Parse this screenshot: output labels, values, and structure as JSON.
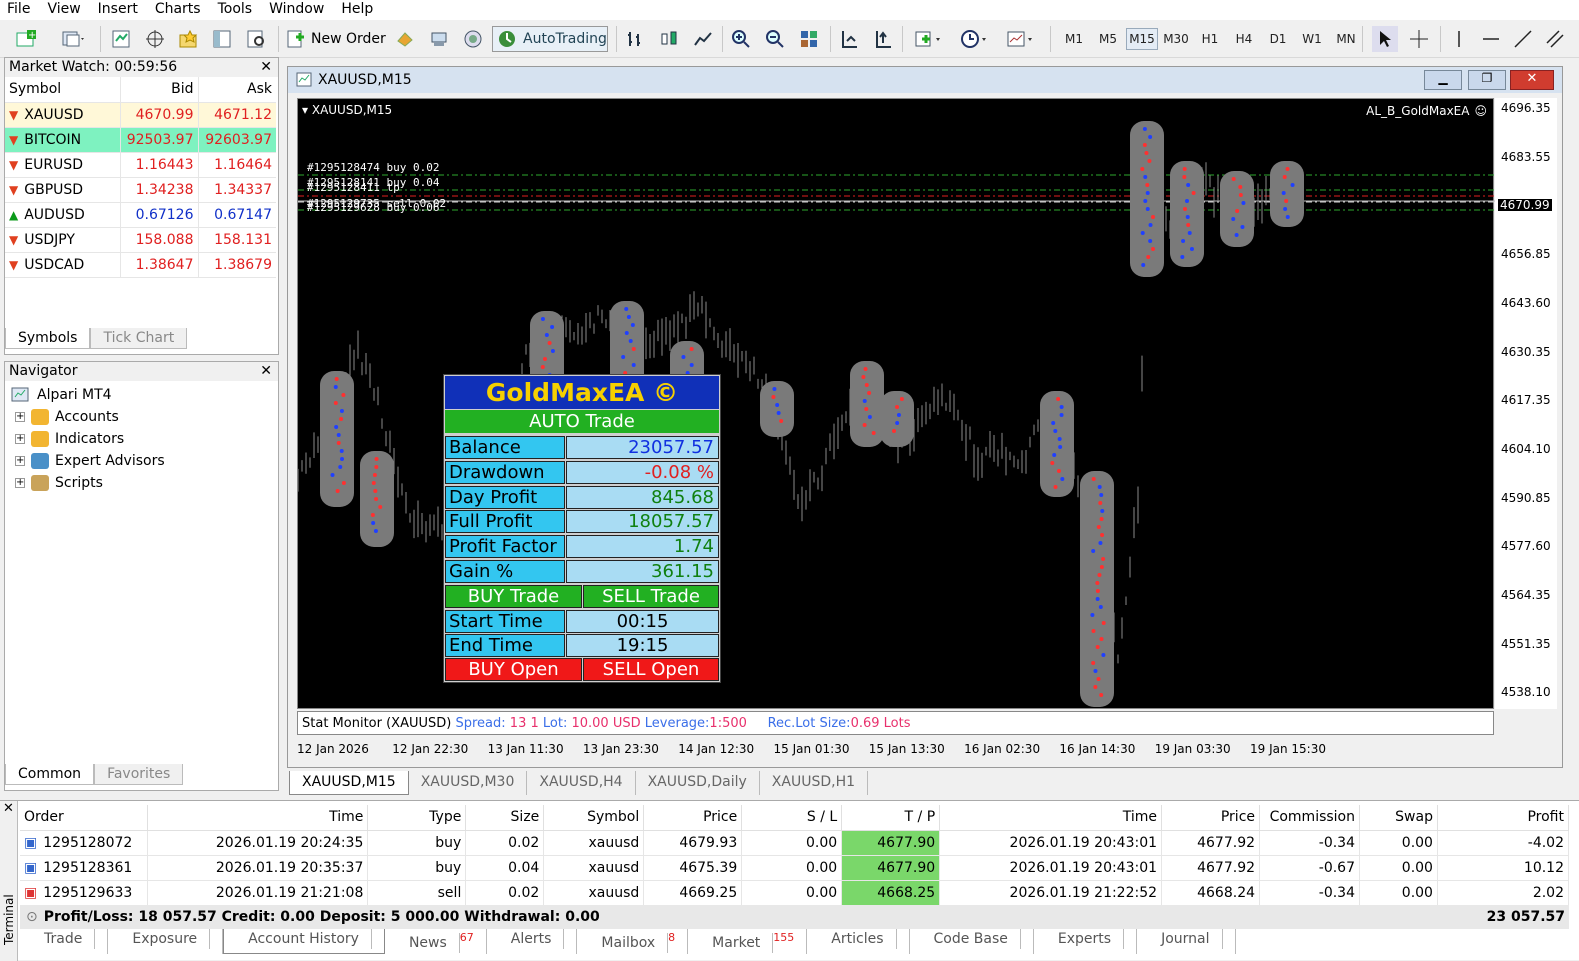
{
  "menu": [
    "File",
    "View",
    "Insert",
    "Charts",
    "Tools",
    "Window",
    "Help"
  ],
  "toolbar": {
    "new_order": "New Order",
    "autotrading": "AutoTrading",
    "timeframes": [
      "M1",
      "M5",
      "M15",
      "M30",
      "H1",
      "H4",
      "D1",
      "W1",
      "MN"
    ],
    "active_tf": "M15"
  },
  "market_watch": {
    "title": "Market Watch: 00:59:56",
    "headers": {
      "symbol": "Symbol",
      "bid": "Bid",
      "ask": "Ask"
    },
    "rows": [
      {
        "symbol": "XAUUSD",
        "bid": "4670.99",
        "ask": "4671.12",
        "dir": "down"
      },
      {
        "symbol": "BITCOIN",
        "bid": "92503.97",
        "ask": "92603.97",
        "dir": "down"
      },
      {
        "symbol": "EURUSD",
        "bid": "1.16443",
        "ask": "1.16464",
        "dir": "down"
      },
      {
        "symbol": "GBPUSD",
        "bid": "1.34238",
        "ask": "1.34337",
        "dir": "down"
      },
      {
        "symbol": "AUDUSD",
        "bid": "0.67126",
        "ask": "0.67147",
        "dir": "up"
      },
      {
        "symbol": "USDJPY",
        "bid": "158.088",
        "ask": "158.131",
        "dir": "down"
      },
      {
        "symbol": "USDCAD",
        "bid": "1.38647",
        "ask": "1.38679",
        "dir": "down"
      }
    ],
    "tabs": [
      "Symbols",
      "Tick Chart"
    ]
  },
  "navigator": {
    "title": "Navigator",
    "root": "Alpari MT4",
    "items": [
      "Accounts",
      "Indicators",
      "Expert Advisors",
      "Scripts"
    ],
    "tabs": [
      "Common",
      "Favorites"
    ]
  },
  "chart": {
    "window_title": "XAUUSD,M15",
    "inner_title": "XAUUSD,M15",
    "ea_label": "AL_B_GoldMaxEA",
    "price_labels": [
      "4696.35",
      "4683.55",
      "4670.99",
      "4656.85",
      "4643.60",
      "4630.35",
      "4617.35",
      "4604.10",
      "4590.85",
      "4577.60",
      "4564.35",
      "4551.35",
      "4538.10"
    ],
    "current_price": "4670.99",
    "date_labels": [
      "12 Jan 2026",
      "12 Jan 22:30",
      "13 Jan 11:30",
      "13 Jan 23:30",
      "14 Jan 12:30",
      "15 Jan 01:30",
      "15 Jan 13:30",
      "16 Jan 02:30",
      "16 Jan 14:30",
      "19 Jan 03:30",
      "19 Jan 15:30"
    ],
    "order_labels": [
      "#1295128474 buy 0.02",
      "#1295128141 buy 0.04",
      "#1295128411 tp",
      "#1295129735 sell 0.02",
      "#1295129628 buy 0.06"
    ],
    "stat_monitor": {
      "prefix": "Stat Monitor (XAUUSD)",
      "spread_lbl": "Spread:",
      "spread": "13 1",
      "lot_lbl": "Lot:",
      "lot": "10.00 USD",
      "lev_lbl": "Leverage:",
      "lev": "1:500",
      "rec_lbl": "Rec.Lot Size:",
      "rec": "0.69 Lots"
    },
    "tabs": [
      "XAUUSD,M15",
      "XAUUSD,M30",
      "XAUUSD,H4",
      "XAUUSD,Daily",
      "XAUUSD,H1"
    ]
  },
  "ea_panel": {
    "title": "GoldMaxEA ©",
    "mode": "AUTO Trade",
    "rows": [
      {
        "label": "Balance",
        "value": "23057.57",
        "color": "#1030e0"
      },
      {
        "label": "Drawdown",
        "value": "-0.08 %",
        "color": "#e02020"
      },
      {
        "label": "Day Profit",
        "value": "845.68",
        "color": "#108010"
      },
      {
        "label": "Full Profit",
        "value": "18057.57",
        "color": "#108010"
      },
      {
        "label": "Profit Factor",
        "value": "1.74",
        "color": "#108010"
      },
      {
        "label": "Gain %",
        "value": "361.15",
        "color": "#108010"
      }
    ],
    "buy_trade": "BUY Trade",
    "sell_trade": "SELL Trade",
    "start_label": "Start Time",
    "start_value": "00:15",
    "end_label": "End Time",
    "end_value": "19:15",
    "buy_open": "BUY Open",
    "sell_open": "SELL Open"
  },
  "terminal": {
    "side_label": "Terminal",
    "headers": [
      "Order",
      "Time",
      "Type",
      "Size",
      "Symbol",
      "Price",
      "S / L",
      "T / P",
      "Time",
      "Price",
      "Commission",
      "Swap",
      "Profit"
    ],
    "rows": [
      [
        "1295128072",
        "2026.01.19 20:24:35",
        "buy",
        "0.02",
        "xauusd",
        "4679.93",
        "0.00",
        "4677.90",
        "2026.01.19 20:43:01",
        "4677.92",
        "-0.34",
        "0.00",
        "-4.02"
      ],
      [
        "1295128361",
        "2026.01.19 20:35:37",
        "buy",
        "0.04",
        "xauusd",
        "4675.39",
        "0.00",
        "4677.90",
        "2026.01.19 20:43:01",
        "4677.92",
        "-0.67",
        "0.00",
        "10.12"
      ],
      [
        "1295129633",
        "2026.01.19 21:21:08",
        "sell",
        "0.02",
        "xauusd",
        "4669.25",
        "0.00",
        "4668.25",
        "2026.01.19 21:22:52",
        "4668.24",
        "-0.34",
        "0.00",
        "2.02"
      ]
    ],
    "summary": "Profit/Loss: 18 057.57  Credit: 0.00  Deposit: 5 000.00  Withdrawal: 0.00",
    "total": "23 057.57",
    "tabs": [
      {
        "label": "Trade",
        "badge": ""
      },
      {
        "label": "Exposure",
        "badge": ""
      },
      {
        "label": "Account History",
        "badge": ""
      },
      {
        "label": "News",
        "badge": "67"
      },
      {
        "label": "Alerts",
        "badge": ""
      },
      {
        "label": "Mailbox",
        "badge": "8"
      },
      {
        "label": "Market",
        "badge": "155"
      },
      {
        "label": "Articles",
        "badge": ""
      },
      {
        "label": "Code Base",
        "badge": ""
      },
      {
        "label": "Experts",
        "badge": ""
      },
      {
        "label": "Journal",
        "badge": ""
      }
    ],
    "active_tab": "Account History"
  }
}
